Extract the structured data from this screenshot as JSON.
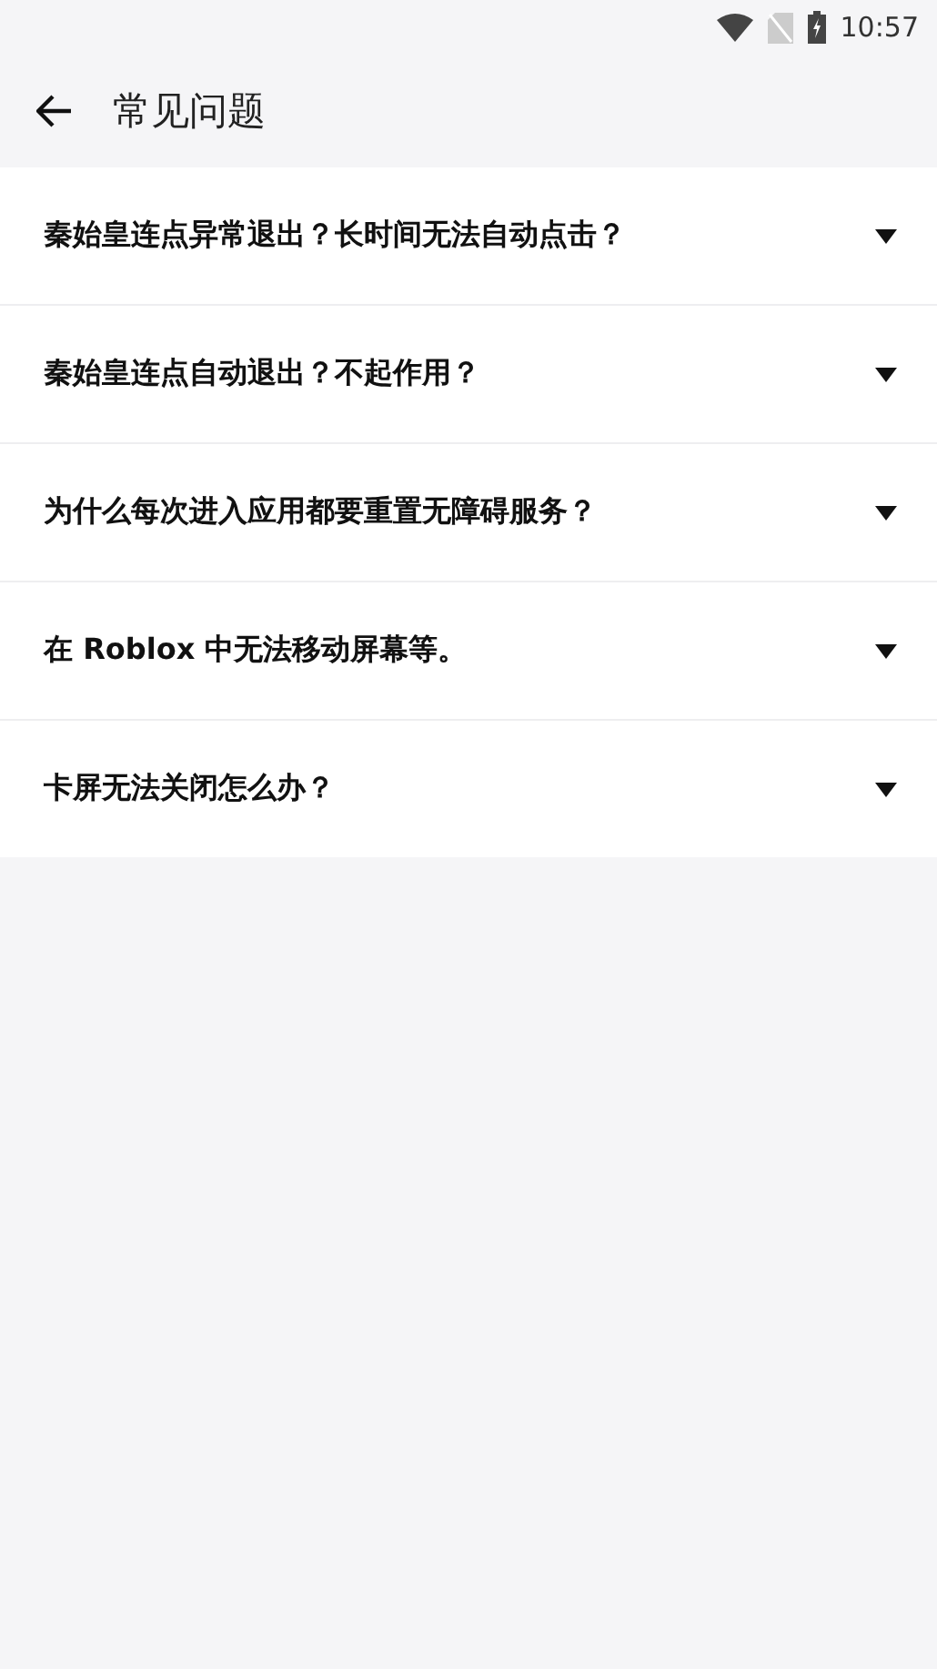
{
  "status_bar": {
    "time": "10:57"
  },
  "app_bar": {
    "title": "常见问题"
  },
  "faq_items": [
    {
      "question": "秦始皇连点异常退出？长时间无法自动点击？",
      "expanded": false
    },
    {
      "question": "秦始皇连点自动退出？不起作用？",
      "expanded": false
    },
    {
      "question": "为什么每次进入应用都要重置无障碍服务？",
      "expanded": false
    },
    {
      "question": "在 Roblox 中无法移动屏幕等。",
      "expanded": false
    },
    {
      "question": "卡屏无法关闭怎么办？",
      "expanded": false
    }
  ]
}
